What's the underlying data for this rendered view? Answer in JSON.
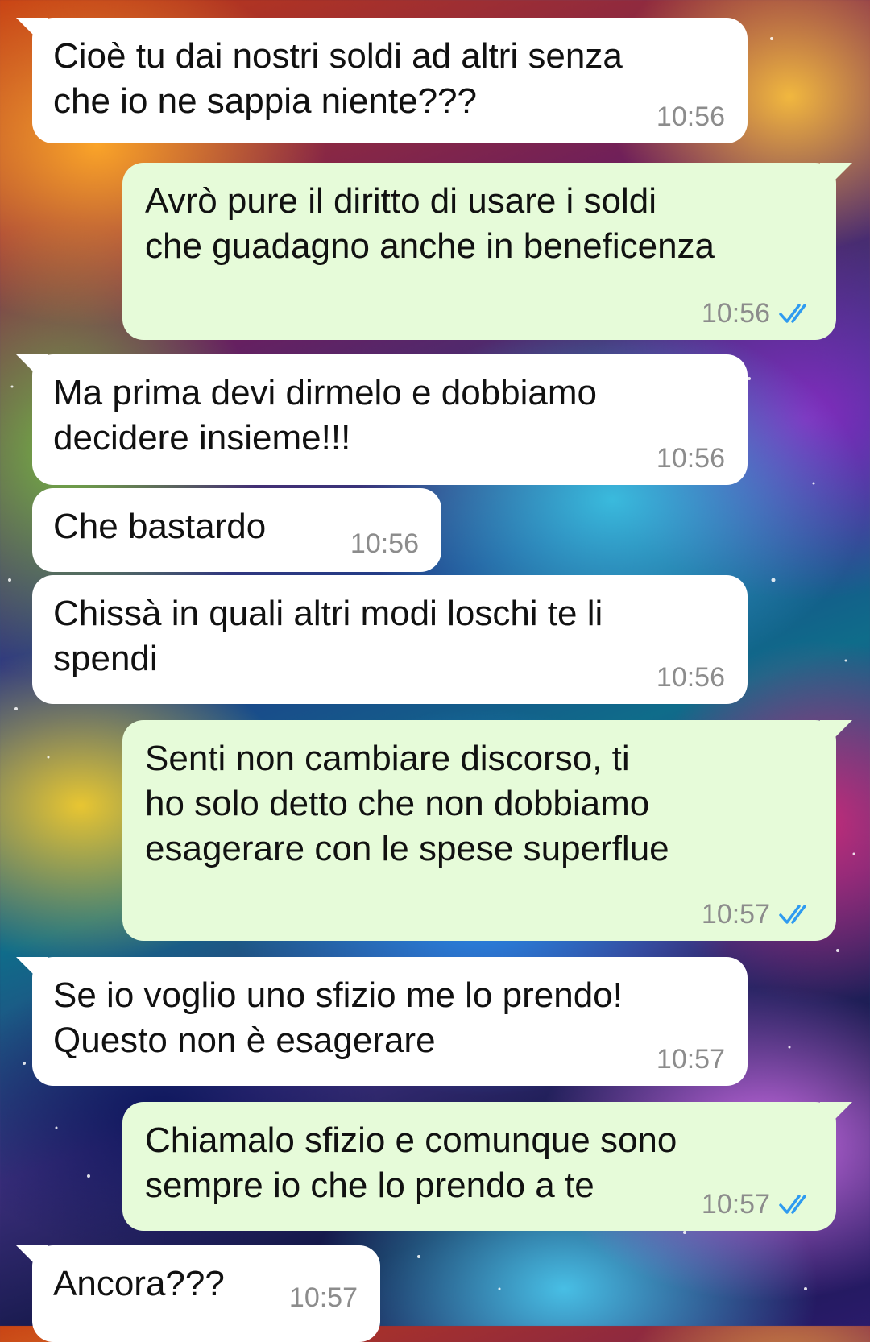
{
  "messages": [
    {
      "id": 1,
      "direction": "incoming",
      "text": "Cioè tu dai nostri soldi ad altri senza\nche io ne sappia niente???",
      "time": "10:56"
    },
    {
      "id": 2,
      "direction": "outgoing",
      "text": "Avrò pure il diritto di usare i soldi\nche guadagno anche in beneficenza",
      "time": "10:56",
      "status": "read-double-check-icon"
    },
    {
      "id": 3,
      "direction": "incoming",
      "text": "Ma prima devi dirmelo e dobbiamo\ndecidere insieme!!!",
      "time": "10:56"
    },
    {
      "id": 4,
      "direction": "incoming",
      "text": "Che bastardo",
      "time": "10:56"
    },
    {
      "id": 5,
      "direction": "incoming",
      "text": "Chissà in quali altri modi loschi te li\nspendi",
      "time": "10:56"
    },
    {
      "id": 6,
      "direction": "outgoing",
      "text": "Senti non cambiare discorso, ti\nho solo detto che non dobbiamo\nesagerare con le spese superflue",
      "time": "10:57",
      "status": "read-double-check-icon"
    },
    {
      "id": 7,
      "direction": "incoming",
      "text": "Se io voglio uno sfizio me lo prendo!\nQuesto non è esagerare",
      "time": "10:57"
    },
    {
      "id": 8,
      "direction": "outgoing",
      "text": "Chiamalo sfizio e comunque sono\nsempre io che lo prendo a te",
      "time": "10:57",
      "status": "read-double-check-icon"
    },
    {
      "id": 9,
      "direction": "incoming",
      "text": "Ancora???",
      "time": "10:57"
    }
  ],
  "colors": {
    "incoming_bubble": "#ffffff",
    "outgoing_bubble": "#e6fbd9",
    "timestamp": "#8c8c8c",
    "read_check": "#2f9bf0"
  }
}
